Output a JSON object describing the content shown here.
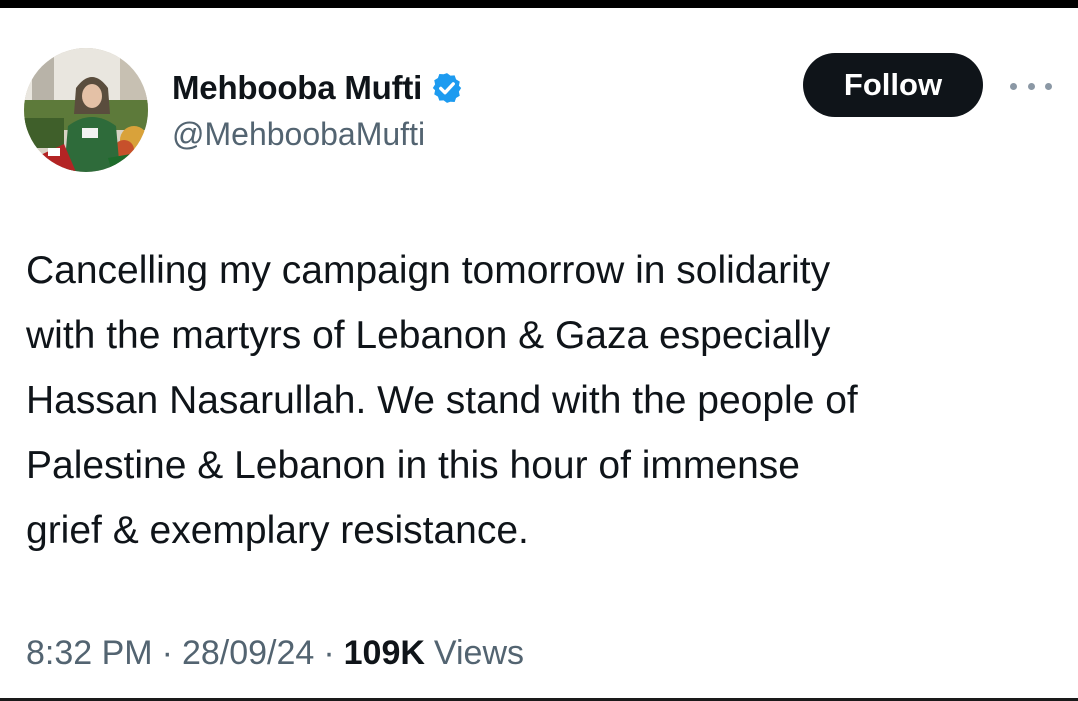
{
  "author": {
    "display_name": "Mehbooba Mufti",
    "handle": "@MehboobaMufti",
    "verified": true,
    "verified_color": "#1d9bf0"
  },
  "actions": {
    "follow_label": "Follow",
    "more_icon": "more-horizontal-icon"
  },
  "tweet": {
    "text_lines": [
      "Cancelling my campaign tomorrow in solidarity",
      "with the martyrs of Lebanon & Gaza especially",
      "Hassan Nasarullah. We stand with the people of",
      "Palestine & Lebanon in this hour of immense",
      "grief & exemplary resistance."
    ]
  },
  "meta": {
    "time": "8:32 PM",
    "separator": "·",
    "date": "28/09/24",
    "views_count": "109K",
    "views_label": "Views"
  }
}
